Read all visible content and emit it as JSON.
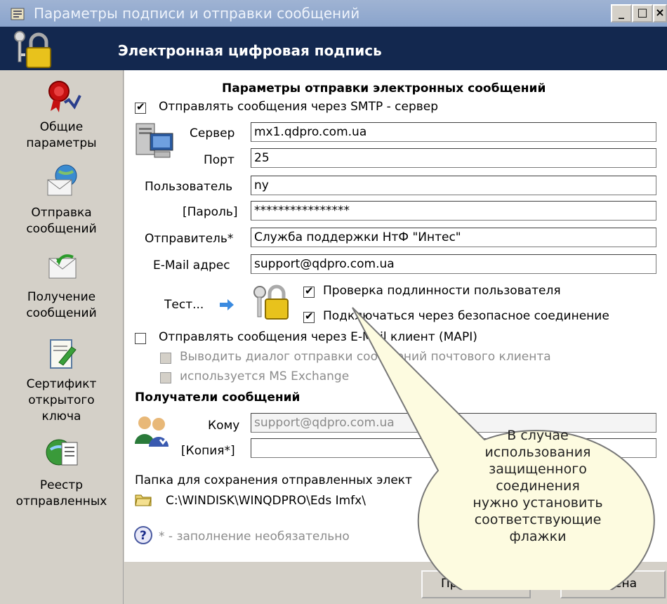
{
  "window": {
    "title": "Параметры подписи и отправки сообщений",
    "controls": [
      "_",
      "□",
      "×"
    ]
  },
  "header": {
    "title": "Электронная цифровая подпись"
  },
  "sidebar": {
    "items": [
      {
        "label": "Общие\nпараметры",
        "icon": "ribbon-award-icon"
      },
      {
        "label": "Отправка\nсообщений",
        "icon": "globe-envelope-icon"
      },
      {
        "label": "Получение\nсообщений",
        "icon": "envelope-receive-icon"
      },
      {
        "label": "Сертификт\nоткрытого\nключа",
        "icon": "certificate-pen-icon"
      },
      {
        "label": "Реестр\nотправленных",
        "icon": "globe-document-icon"
      }
    ]
  },
  "main": {
    "section_title": "Параметры отправки электронных сообщений",
    "smtp_checkbox": {
      "label": "Отправлять сообщения через SMTP - сервер",
      "checked": true
    },
    "server": {
      "label": "Сервер",
      "value": "mx1.qdpro.com.ua"
    },
    "port": {
      "label": "Порт",
      "value": "25"
    },
    "user": {
      "label": "Пользователь",
      "value": "ny"
    },
    "password": {
      "label": "[Пароль]",
      "value": "****************"
    },
    "sender": {
      "label": "Отправитель*",
      "value": "Служба поддержки НтФ \"Интес\""
    },
    "email": {
      "label": "E-Mail адрес",
      "value": "support@qdpro.com.ua"
    },
    "test_label": "Тест...",
    "auth_checkbox": {
      "label": "Проверка подлинности пользователя",
      "checked": true
    },
    "secure_checkbox": {
      "label": "Подключаться через безопасное соединение",
      "checked": true
    },
    "mapi_checkbox": {
      "label": "Отправлять сообщения через E-Mail клиент (MAPI)",
      "checked": false
    },
    "mapi_dialog_checkbox": {
      "label": "Выводить диалог отправки сообщений почтового клиента",
      "checked": false
    },
    "exchange_checkbox": {
      "label": "используется MS Exchange",
      "checked": false
    },
    "recipients_title": "Получатели сообщений",
    "to": {
      "label": "Кому",
      "value": "support@qdpro.com.ua"
    },
    "cc": {
      "label": "[Копия*]",
      "value": ""
    },
    "folder_label": "Папка для сохранения отправленных элект",
    "folder_path": "C:\\WINDISK\\WINQDPRO\\Eds Imfx\\",
    "optional_note": "* - заполнение необязательно"
  },
  "footer": {
    "apply_label": "Применить",
    "cancel_label": "Отмена"
  },
  "callout": {
    "text": "В случае\nиспользования\nзащищенного\nсоединения\nнужно установить\nсоответствующие\nфлажки"
  },
  "colors": {
    "header_bg": "#13284f",
    "titlebar_bg": "#8aa4cc",
    "callout_bg": "#fdfbe0",
    "window_bg": "#d4d0c8"
  }
}
